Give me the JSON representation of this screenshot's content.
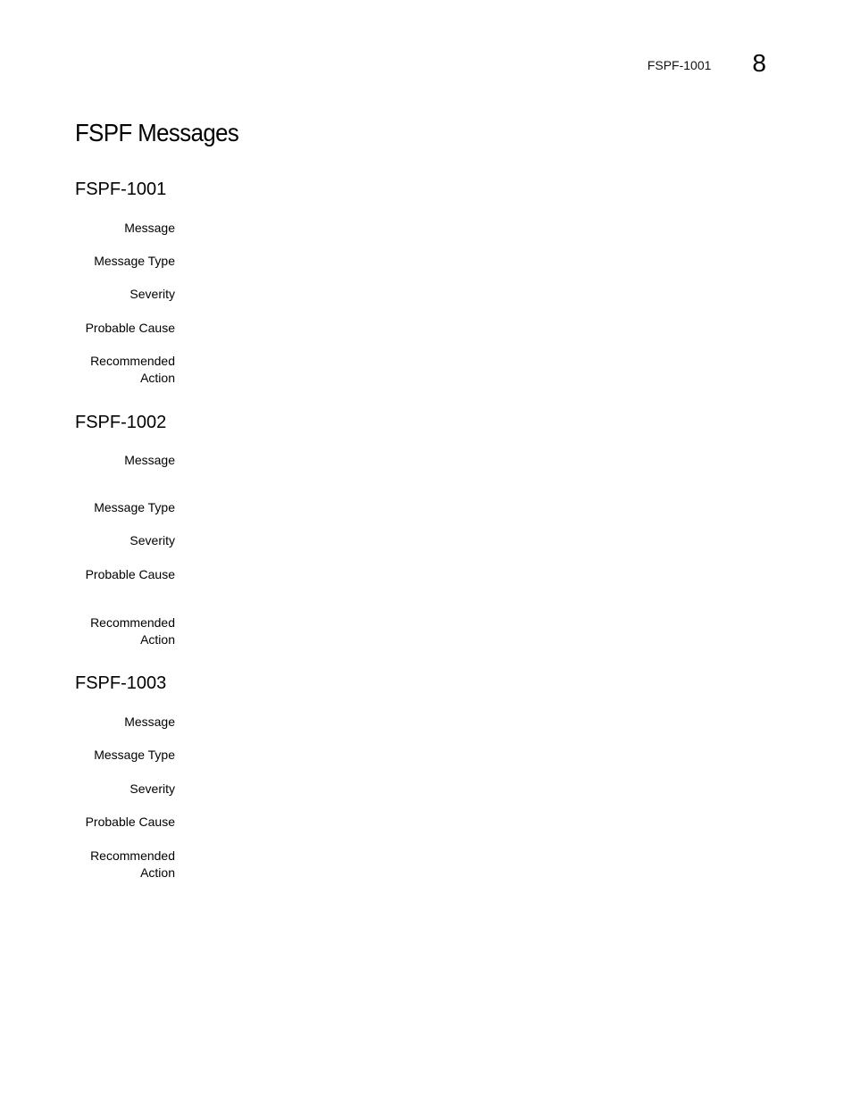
{
  "header": {
    "running_title": "FSPF-1001",
    "chapter_number": "8"
  },
  "page_title": "FSPF Messages",
  "sections": [
    {
      "id": "FSPF-1001",
      "fields": [
        {
          "label": "Message",
          "value": ""
        },
        {
          "label": "Message Type",
          "value": ""
        },
        {
          "label": "Severity",
          "value": ""
        },
        {
          "label": "Probable Cause",
          "value": ""
        },
        {
          "label": "Recommended Action",
          "label_line1": "Recommended",
          "label_line2": "Action",
          "value": ""
        }
      ]
    },
    {
      "id": "FSPF-1002",
      "fields": [
        {
          "label": "Message",
          "value": ""
        },
        {
          "label": "Message Type",
          "value": ""
        },
        {
          "label": "Severity",
          "value": ""
        },
        {
          "label": "Probable Cause",
          "value": ""
        },
        {
          "label": "Recommended Action",
          "label_line1": "Recommended",
          "label_line2": "Action",
          "value": ""
        }
      ]
    },
    {
      "id": "FSPF-1003",
      "fields": [
        {
          "label": "Message",
          "value": ""
        },
        {
          "label": "Message Type",
          "value": ""
        },
        {
          "label": "Severity",
          "value": ""
        },
        {
          "label": "Probable Cause",
          "value": ""
        },
        {
          "label": "Recommended Action",
          "label_line1": "Recommended",
          "label_line2": "Action",
          "value": ""
        }
      ]
    }
  ]
}
